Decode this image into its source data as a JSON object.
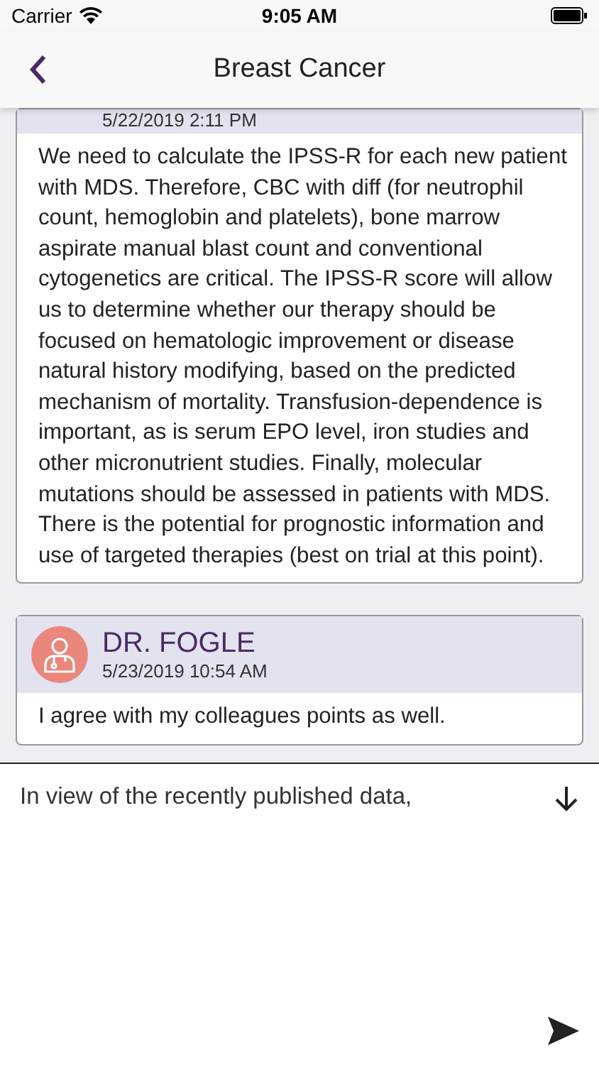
{
  "status_bar": {
    "carrier": "Carrier",
    "time": "9:05 AM"
  },
  "nav": {
    "title": "Breast Cancer"
  },
  "comments": [
    {
      "timestamp": "5/22/2019 2:11 PM",
      "body": "We need to calculate the IPSS-R for each new patient with MDS. Therefore, CBC with diff (for neutrophil count, hemoglobin and platelets), bone marrow aspirate manual blast count and conventional cytogenetics are critical. The IPSS-R score will allow us to determine whether our therapy should be focused on hematologic improvement or disease natural history modifying, based on the predicted mechanism of mortality. Transfusion-dependence is important, as is serum EPO level, iron studies and other micronutrient studies. Finally, molecular mutations should be assessed in patients with MDS. There is the potential for prognostic information and use of targeted therapies (best on trial at this point)."
    },
    {
      "author": "DR. FOGLE",
      "timestamp": "5/23/2019 10:54 AM",
      "body": "I agree with my colleagues points as well."
    }
  ],
  "composer": {
    "value": "In view of the recently published data,"
  }
}
